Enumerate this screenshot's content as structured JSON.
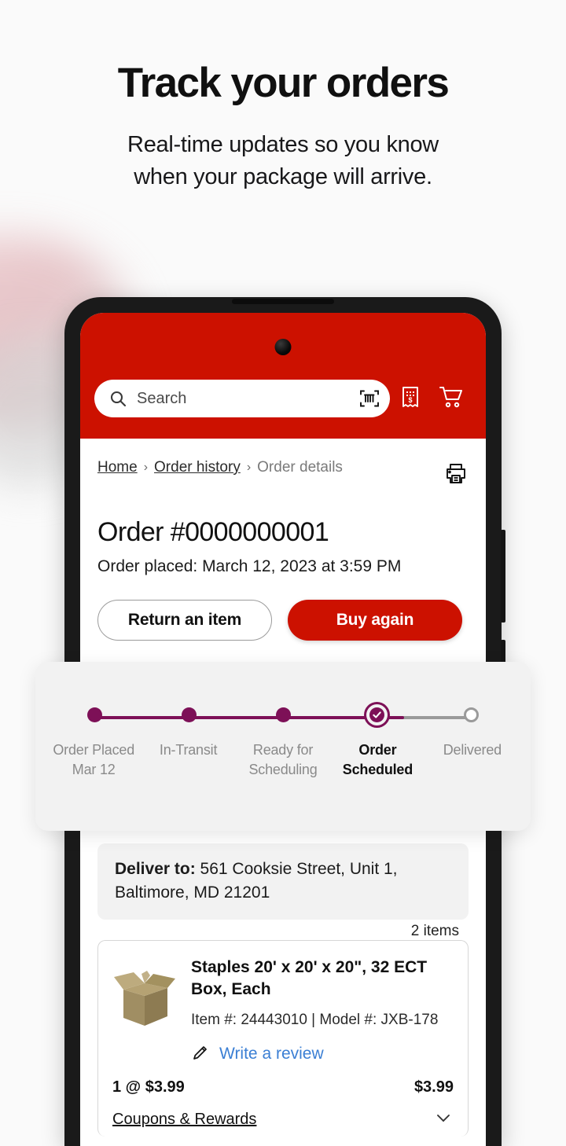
{
  "promo": {
    "title": "Track your orders",
    "subtitle_line1": "Real-time updates so you know",
    "subtitle_line2": "when your package will arrive."
  },
  "app_header": {
    "search_placeholder": "Search",
    "icons": {
      "search": "search-icon",
      "scan": "barcode-scan-icon",
      "deals": "receipt-deals-icon",
      "cart": "shopping-cart-icon"
    },
    "brand_red": "#cc1100"
  },
  "breadcrumb": {
    "home": "Home",
    "order_history": "Order history",
    "current": "Order details",
    "separator": "›"
  },
  "order": {
    "title": "Order #0000000001",
    "placed": "Order placed: March 12, 2023 at 3:59 PM",
    "print_icon": "printer-icon"
  },
  "actions": {
    "return_label": "Return an item",
    "buy_again_label": "Buy again"
  },
  "tracker": {
    "accent_color": "#7d1057",
    "inactive_color": "#9a9a9a",
    "current_index": 3,
    "steps": [
      {
        "label": "Order Placed",
        "sub": "Mar 12",
        "state": "complete"
      },
      {
        "label": "In-Transit",
        "sub": "",
        "state": "complete"
      },
      {
        "label": "Ready for",
        "sub": "Scheduling",
        "state": "complete"
      },
      {
        "label": "Order",
        "sub": "Scheduled",
        "state": "current"
      },
      {
        "label": "Delivered",
        "sub": "",
        "state": "pending"
      }
    ]
  },
  "delivery": {
    "label": "Deliver to:",
    "address_line1": "561 Cooksie Street, Unit 1,",
    "address_line2": "Baltimore, MD 21201"
  },
  "items_section": {
    "count_label": "2 items",
    "item": {
      "name": "Staples 20' x 20' x 20\", 32 ECT Box, Each",
      "meta": "Item #: 24443010 | Model #: JXB-178",
      "review_label": "Write a review",
      "review_icon": "pencil-icon",
      "quantity_price": "1 @ $3.99",
      "line_total": "$3.99",
      "coupons_label": "Coupons & Rewards",
      "coupons_icon": "chevron-down-icon",
      "thumbnail": "cardboard-box-image"
    }
  }
}
